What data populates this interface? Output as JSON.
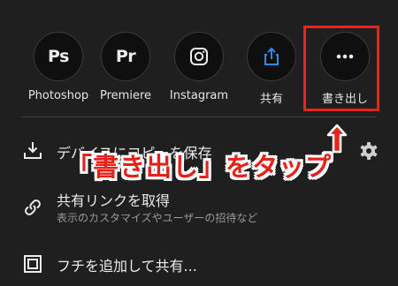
{
  "share_targets": [
    {
      "abbr": "Ps",
      "label": "Photoshop",
      "icon": "photoshop-icon"
    },
    {
      "abbr": "Pr",
      "label": "Premiere",
      "icon": "premiere-icon"
    },
    {
      "abbr": "",
      "label": "Instagram",
      "icon": "instagram-icon"
    },
    {
      "abbr": "",
      "label": "共有",
      "icon": "share-upload-icon"
    },
    {
      "abbr": "",
      "label": "書き出し",
      "icon": "more-dots-icon"
    }
  ],
  "menu": {
    "copy_to_device": "デバイスにコピーを保存",
    "get_share_link": "共有リンクを取得",
    "share_link_sub": "表示のカスタマイズやユーザーの招待など",
    "add_frame_share": "フチを追加して共有..."
  },
  "annotation": {
    "callout": "「書き出し」をタップ",
    "color": "#e4261d"
  },
  "colors": {
    "background": "#1f1f1f",
    "accent_blue": "#2d8ceb"
  }
}
